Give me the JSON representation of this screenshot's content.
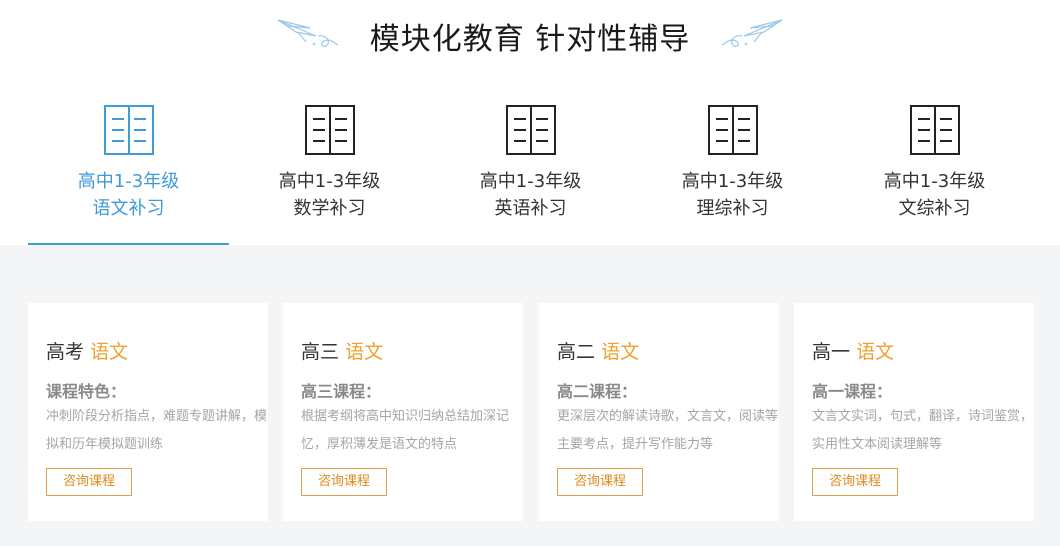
{
  "header": {
    "title": "模块化教育 针对性辅导"
  },
  "tabs": [
    {
      "line1": "高中1-3年级",
      "line2": "语文补习",
      "active": true
    },
    {
      "line1": "高中1-3年级",
      "line2": "数学补习",
      "active": false
    },
    {
      "line1": "高中1-3年级",
      "line2": "英语补习",
      "active": false
    },
    {
      "line1": "高中1-3年级",
      "line2": "理综补习",
      "active": false
    },
    {
      "line1": "高中1-3年级",
      "line2": "文综补习",
      "active": false
    }
  ],
  "cards": [
    {
      "grade": "高考",
      "subject": "语文",
      "feature_label": "课程特色：",
      "description": "冲刺阶段分析指点，难题专题讲解，模拟和历年模拟题训练",
      "button": "咨询课程"
    },
    {
      "grade": "高三",
      "subject": "语文",
      "feature_label": "高三课程：",
      "description": "根据考纲将高中知识归纳总结加深记忆，厚积薄发是语文的特点",
      "button": "咨询课程"
    },
    {
      "grade": "高二",
      "subject": "语文",
      "feature_label": "高二课程：",
      "description": "更深层次的解读诗歌，文言文，阅读等主要考点，提升写作能力等",
      "button": "咨询课程"
    },
    {
      "grade": "高一",
      "subject": "语文",
      "feature_label": "高一课程：",
      "description": "文言文实词，句式，翻译，诗词鉴赏，实用性文本阅读理解等",
      "button": "咨询课程"
    }
  ],
  "colors": {
    "accent_blue": "#3f9ad8",
    "accent_orange": "#f0a030",
    "content_bg": "#f4f5f7"
  },
  "icons": {
    "tab_icon": "book-icon",
    "header_decoration": "paper-plane-icon"
  }
}
